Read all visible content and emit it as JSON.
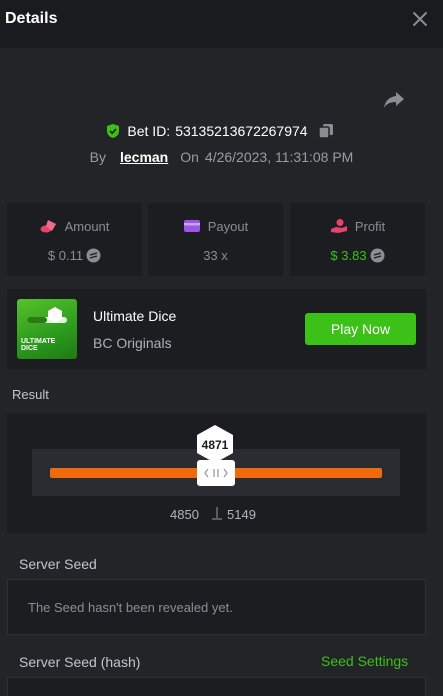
{
  "header": {
    "title": "Details"
  },
  "bet": {
    "id_label": "Bet ID:",
    "id_value": "53135213672267974",
    "by_label": "By",
    "user": "lecman",
    "on_label": "On",
    "datetime": "4/26/2023, 11:31:08 PM"
  },
  "stats": [
    {
      "label": "Amount",
      "value": "$ 0.11"
    },
    {
      "label": "Payout",
      "value": "33 x"
    },
    {
      "label": "Profit",
      "value": "$ 3.83"
    }
  ],
  "game": {
    "name": "Ultimate Dice",
    "provider": "BC Originals",
    "thumb_text_1": "ULTIMATE",
    "thumb_text_2": "DICE",
    "play_label": "Play Now"
  },
  "result": {
    "label": "Result",
    "roll": "4871",
    "range_low": "4850",
    "range_high": "5149"
  },
  "server_seed": {
    "label": "Server Seed",
    "text": "The Seed hasn't been revealed yet."
  },
  "server_seed_hash": {
    "label": "Server Seed (hash)",
    "settings_link": "Seed Settings"
  },
  "colors": {
    "accent_green": "#3bc117",
    "profit_green": "#3bc117",
    "track_orange": "#ef6a0b",
    "background": "#232428",
    "panel": "#1c1d21"
  },
  "icons": {
    "close": "close-icon",
    "share": "share-icon",
    "shield": "shield-check-icon",
    "copy": "copy-icon",
    "amount": "bet-chips-icon",
    "payout": "wallet-icon",
    "profit": "profit-hand-icon",
    "coin": "coin-icon"
  }
}
